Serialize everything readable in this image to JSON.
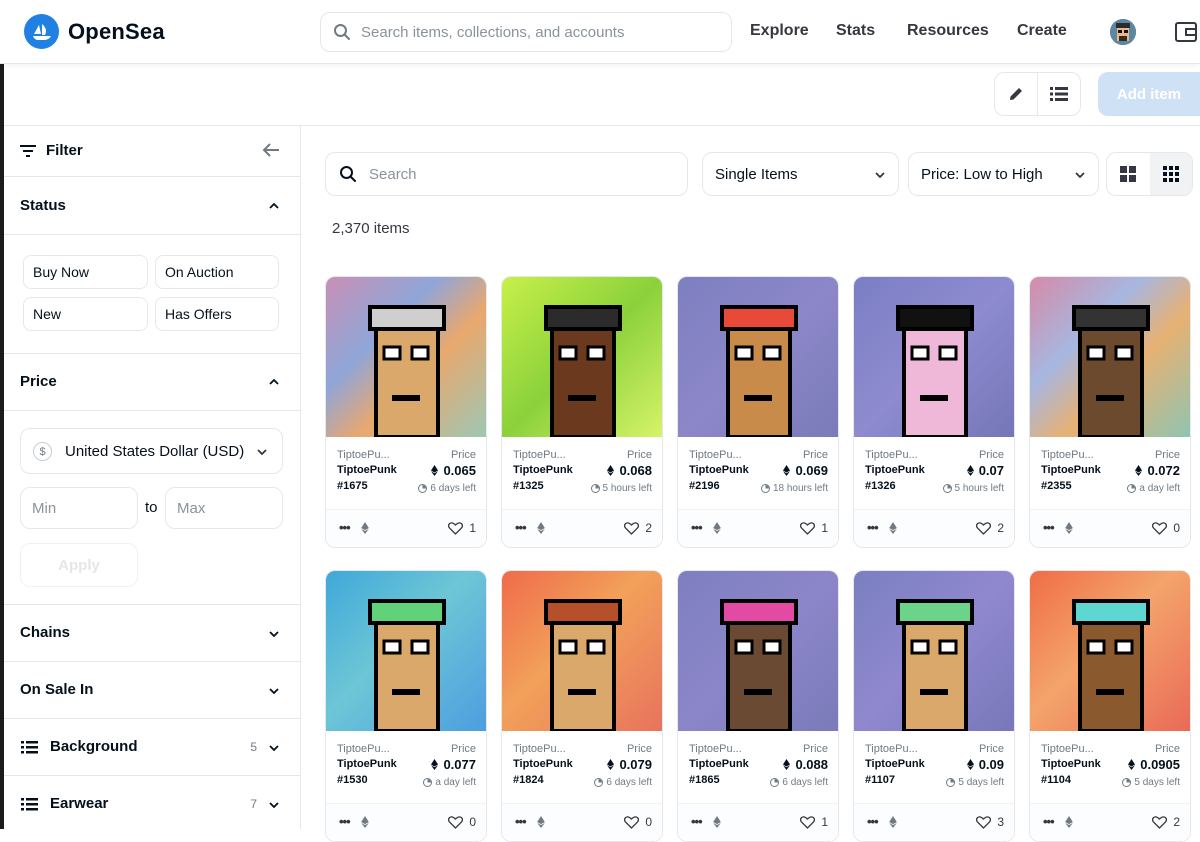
{
  "header": {
    "brand": "OpenSea",
    "search_placeholder": "Search items, collections, and accounts",
    "nav": [
      "Explore",
      "Stats",
      "Resources",
      "Create"
    ]
  },
  "toolbar": {
    "add_item_label": "Add item"
  },
  "sidebar": {
    "filter_label": "Filter",
    "status": {
      "title": "Status",
      "options": [
        "Buy Now",
        "On Auction",
        "New",
        "Has Offers"
      ]
    },
    "price": {
      "title": "Price",
      "currency": "United States Dollar (USD)",
      "currency_symbol": "$",
      "min_placeholder": "Min",
      "max_placeholder": "Max",
      "to_label": "to",
      "apply_label": "Apply"
    },
    "chains_title": "Chains",
    "on_sale_title": "On Sale In",
    "background": {
      "title": "Background",
      "count": "5"
    },
    "earwear": {
      "title": "Earwear",
      "count": "7"
    }
  },
  "main": {
    "search_placeholder": "Search",
    "type_filter": "Single Items",
    "sort": "Price: Low to High",
    "items_count": "2,370 items",
    "price_label": "Price"
  },
  "colors": {
    "accent": "#2081e2",
    "add_item_disabled": "#cfe1f5"
  },
  "cards": [
    {
      "collection": "TiptoePu...",
      "name": "TiptoePunk",
      "number": "#1675",
      "price": "0.065",
      "time": "6 days left",
      "likes": "1"
    },
    {
      "collection": "TiptoePu...",
      "name": "TiptoePunk",
      "number": "#1325",
      "price": "0.068",
      "time": "5 hours left",
      "likes": "2"
    },
    {
      "collection": "TiptoePu...",
      "name": "TiptoePunk",
      "number": "#2196",
      "price": "0.069",
      "time": "18 hours left",
      "likes": "1"
    },
    {
      "collection": "TiptoePu...",
      "name": "TiptoePunk",
      "number": "#1326",
      "price": "0.07",
      "time": "5 hours left",
      "likes": "2"
    },
    {
      "collection": "TiptoePu...",
      "name": "TiptoePunk",
      "number": "#2355",
      "price": "0.072",
      "time": "a day left",
      "likes": "0"
    },
    {
      "collection": "TiptoePu...",
      "name": "TiptoePunk",
      "number": "#1530",
      "price": "0.077",
      "time": "a day left",
      "likes": "0"
    },
    {
      "collection": "TiptoePu...",
      "name": "TiptoePunk",
      "number": "#1824",
      "price": "0.079",
      "time": "6 days left",
      "likes": "0"
    },
    {
      "collection": "TiptoePu...",
      "name": "TiptoePunk",
      "number": "#1865",
      "price": "0.088",
      "time": "6 days left",
      "likes": "1"
    },
    {
      "collection": "TiptoePu...",
      "name": "TiptoePunk",
      "number": "#1107",
      "price": "0.09",
      "time": "5 days left",
      "likes": "3"
    },
    {
      "collection": "TiptoePu...",
      "name": "TiptoePunk",
      "number": "#1104",
      "price": "0.0905",
      "time": "5 days left",
      "likes": "2"
    }
  ]
}
